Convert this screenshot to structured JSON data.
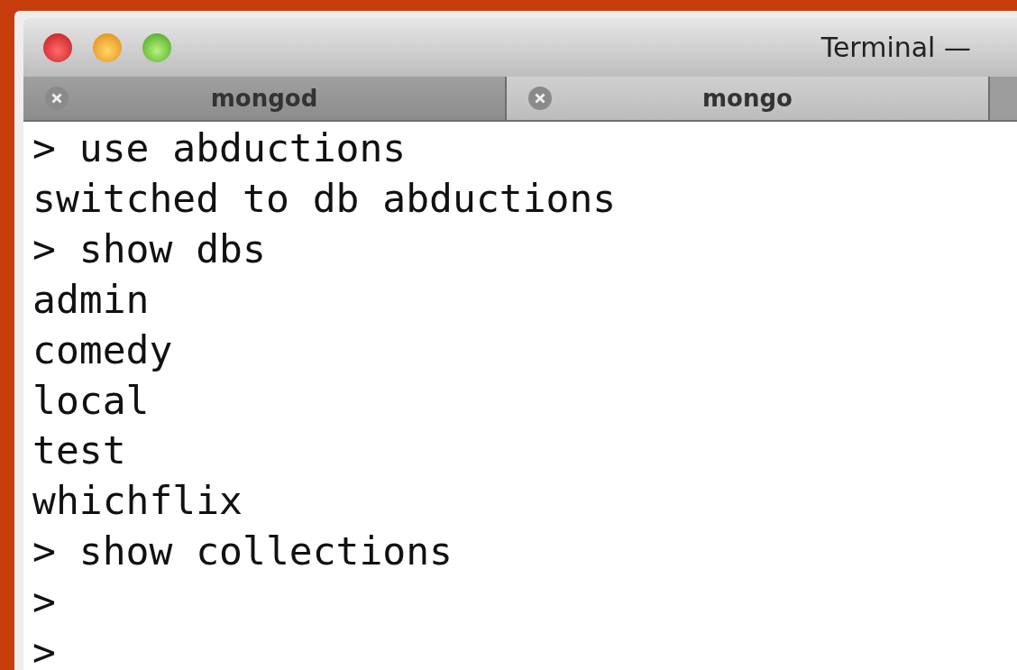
{
  "window": {
    "title": "Terminal —"
  },
  "tabs": [
    {
      "label": "mongod",
      "selected": false
    },
    {
      "label": "mongo",
      "selected": true
    }
  ],
  "lines": [
    "> use abductions",
    "switched to db abductions",
    "> show dbs",
    "admin",
    "comedy",
    "local",
    "test",
    "whichflix",
    "> show collections",
    ">",
    ">"
  ]
}
